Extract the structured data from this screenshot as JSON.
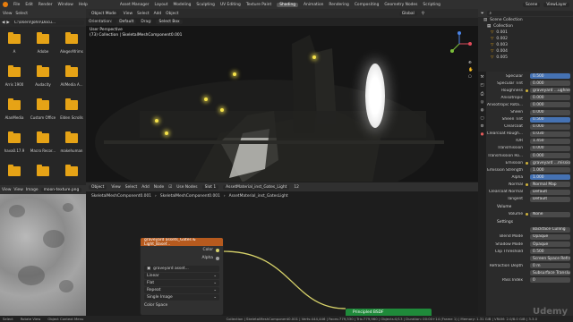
{
  "topbar": {
    "menu": [
      "File",
      "Edit",
      "Render",
      "Window",
      "Help"
    ],
    "workspaces": [
      "Asset Manager",
      "Layout",
      "Modeling",
      "Sculpting",
      "UV Editing",
      "Texture Paint",
      "Shading",
      "Animation",
      "Rendering",
      "Compositing",
      "Geometry Nodes",
      "Scripting"
    ],
    "active_workspace": "Shading",
    "scene": "Scene",
    "view_layer": "ViewLayer"
  },
  "filebrowser": {
    "menu": [
      "View",
      "Select"
    ],
    "path": "C:\\Users\\John\\Docu...",
    "items": [
      "A",
      "Adobe",
      "AlegerAfrims",
      "Arris 1900",
      "Audacity",
      "AVMedia A...",
      "AlanMedia",
      "Custom Office",
      "Elden Scrolls",
      "hava0.17.9",
      "Macro Recor...",
      "makehuman",
      "",
      "",
      ""
    ]
  },
  "image_editor": {
    "menu": [
      "View",
      "View",
      "Image"
    ],
    "image_name": "moon-texture.png"
  },
  "viewport": {
    "mode": "Object Mode",
    "menu": [
      "View",
      "Select",
      "Add",
      "Object"
    ],
    "orientation": "Orientation:",
    "orientation_value": "Default",
    "drag": "Drag:",
    "drag_value": "Select Box",
    "global": "Global",
    "label_line1": "User Perspective",
    "label_line2": "(73) Collection | SkeletalMeshComponent0.001"
  },
  "node_editor": {
    "type": "Object",
    "menu": [
      "View",
      "Select",
      "Add",
      "Node"
    ],
    "use_nodes": "Use Nodes",
    "slot": "Slot 1",
    "material": "AssetMaterial_inst_Gates_Light",
    "users": "12",
    "breadcrumb": [
      "SkeletalMeshComponent0.001",
      "SkeletalMeshComponent0.001",
      "AssetMaterial_inst_GatesLight"
    ],
    "node_title": "graveyard assets_Gates & Light_Basef...",
    "out_color": "Color",
    "out_alpha": "Alpha",
    "image_name": "graveyard asset...",
    "dropdowns": [
      "Linear",
      "Flat",
      "Repeat",
      "Single Image"
    ],
    "color_space": "Color Space",
    "bsdf": "Principled BSDF"
  },
  "outliner": {
    "title": "Scene Collection",
    "rows": [
      "Collection",
      "0.001",
      "0.002",
      "0.003",
      "0.004",
      "0.005"
    ]
  },
  "properties": {
    "rows": [
      {
        "label": "Specular",
        "value": "0.500",
        "blue": true
      },
      {
        "label": "Specular Tint",
        "value": "0.000"
      },
      {
        "label": "Roughness",
        "value": "graveyard ...ughness.png",
        "dot": true
      },
      {
        "label": "Anisotropic",
        "value": "0.000"
      },
      {
        "label": "Anisotropic Rota...",
        "value": "0.000"
      },
      {
        "label": "Sheen",
        "value": "0.000"
      },
      {
        "label": "Sheen Tint",
        "value": "0.500",
        "blue": true
      },
      {
        "label": "Clearcoat",
        "value": "0.000"
      },
      {
        "label": "Clearcoat Rough...",
        "value": "0.030"
      },
      {
        "label": "IOR",
        "value": "1.450"
      },
      {
        "label": "Transmission",
        "value": "0.000"
      },
      {
        "label": "Transmission Ro...",
        "value": "0.000"
      },
      {
        "label": "Emission",
        "value": "graveyard ...mission.png",
        "dot": true
      },
      {
        "label": "Emission Strength",
        "value": "1.000"
      },
      {
        "label": "Alpha",
        "value": "1.000",
        "blue": true
      },
      {
        "label": "Normal",
        "value": "Normal Map",
        "dot": true
      },
      {
        "label": "Clearcoat Normal",
        "value": "Default"
      },
      {
        "label": "Tangent",
        "value": "Default"
      }
    ],
    "volume_header": "Volume",
    "volume_row": {
      "label": "Volume",
      "value": "None"
    },
    "settings_header": "Settings",
    "settings_rows": [
      {
        "label": "",
        "value": "Backface Culling"
      },
      {
        "label": "Blend Mode",
        "value": "Opaque"
      },
      {
        "label": "Shadow Mode",
        "value": "Opaque"
      },
      {
        "label": "Clip Threshold",
        "value": "0.500"
      },
      {
        "label": "",
        "value": "Screen Space Refraction"
      },
      {
        "label": "Refraction Depth",
        "value": "0 m"
      },
      {
        "label": "",
        "value": "Subsurface Translucency"
      },
      {
        "label": "Pass Index",
        "value": "0"
      }
    ]
  },
  "statusbar": {
    "items": [
      "Select",
      "Rotate View",
      "Object Context Menu"
    ],
    "info": "Collection | SkeletalMeshComponent0.001 | Verts:444,446 | Faces:779,530 | Tris:779,960 | Objects:0/13 | Duration: 00:00+14 (Frame 1) | Memory: 1.31 GiB | VRAM: 2.0/8.0 GiB | 3.3.0"
  },
  "watermark": "Udemy"
}
